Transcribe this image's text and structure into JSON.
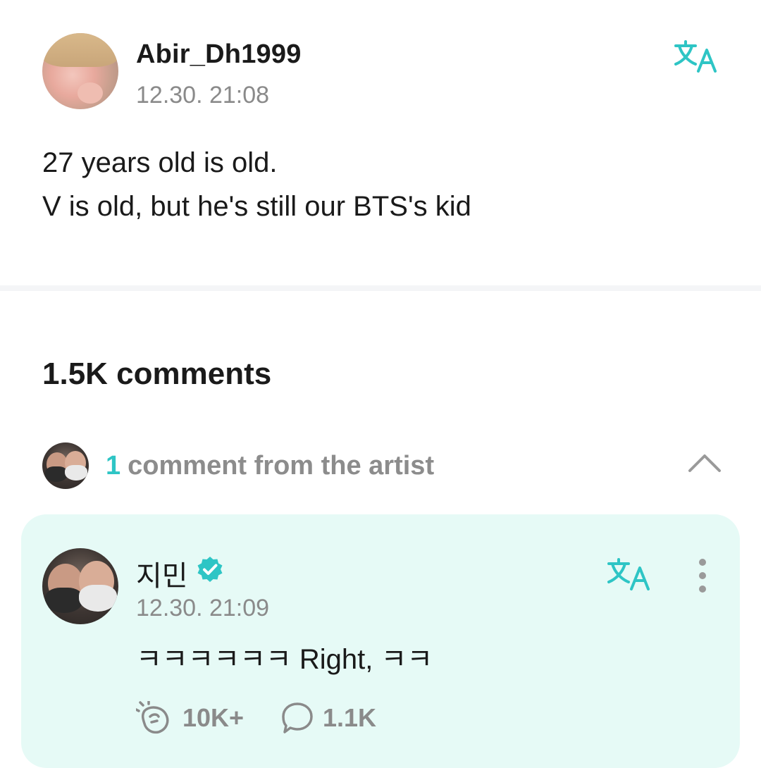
{
  "post": {
    "username": "Abir_Dh1999",
    "timestamp": "12.30. 21:08",
    "body_lines": [
      "27 years old is old.",
      "V is old, but he's still our BTS's kid"
    ]
  },
  "comments": {
    "count_label": "1.5K comments",
    "artist_row": {
      "count": "1",
      "label": "comment from the artist"
    }
  },
  "artist_comment": {
    "name": "지민",
    "timestamp": "12.30. 21:09",
    "text": "ㅋㅋㅋㅋㅋㅋ Right, ㅋㅋ",
    "likes": "10K+",
    "replies": "1.1K"
  },
  "colors": {
    "accent": "#2ec5c5",
    "card_bg": "#e6faf6",
    "muted_text": "#8a8a8a"
  },
  "icons": [
    "translate-icon",
    "verified-badge-icon",
    "more-options-icon",
    "chevron-up-icon",
    "cheer-icon",
    "comment-bubble-icon"
  ]
}
